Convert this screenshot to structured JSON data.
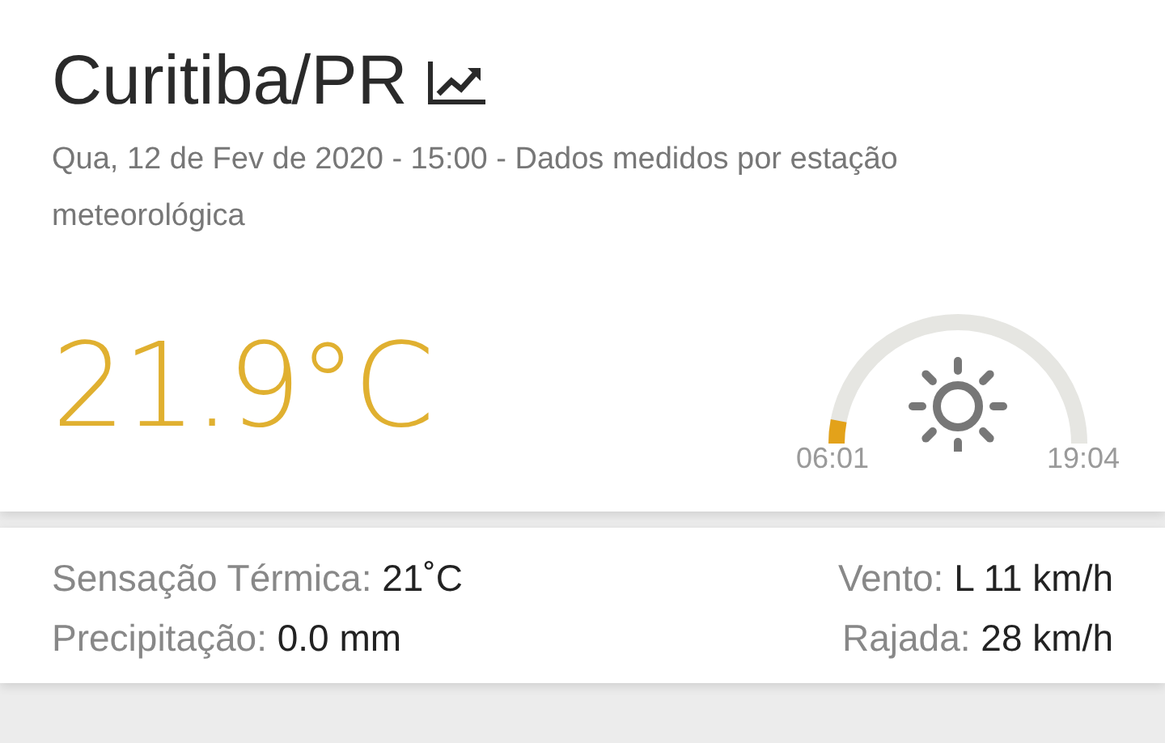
{
  "location": {
    "title": "Curitiba/PR",
    "subtitle": "Qua, 12 de Fev de 2020 - 15:00 - Dados medidos por estação meteorológica"
  },
  "temperature": "21.9°C",
  "sun": {
    "sunrise": "06:01",
    "sunset": "19:04"
  },
  "details": [
    {
      "label": "Sensação Térmica:",
      "value": "21˚C"
    },
    {
      "label": "Vento:",
      "value": "L 11 km/h"
    },
    {
      "label": "Precipitação:",
      "value": "0.0 mm"
    },
    {
      "label": "Rajada:",
      "value": "28 km/h"
    }
  ]
}
